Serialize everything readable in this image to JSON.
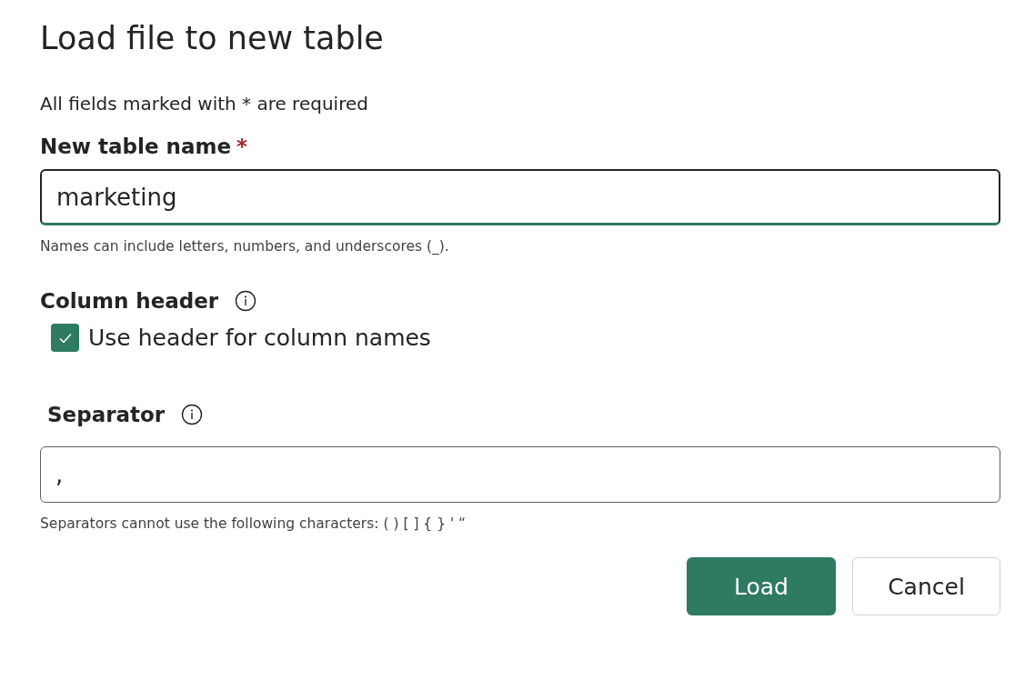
{
  "dialog": {
    "title": "Load file to new table",
    "required_note": "All fields marked with * are required"
  },
  "table_name": {
    "label": "New table name",
    "required_mark": "*",
    "value": "marketing",
    "focused": true,
    "hint": "Names can include letters, numbers, and underscores (_)."
  },
  "column_header": {
    "label": "Column header",
    "checkbox": {
      "label": "Use header for column names",
      "checked": true
    }
  },
  "separator": {
    "label": "Separator",
    "value": ",",
    "focused": false,
    "hint": "Separators cannot use the following characters: ( ) [ ] { } ' “"
  },
  "buttons": [
    {
      "label": "Load",
      "kind": "primary"
    },
    {
      "label": "Cancel",
      "kind": "secondary"
    }
  ]
}
